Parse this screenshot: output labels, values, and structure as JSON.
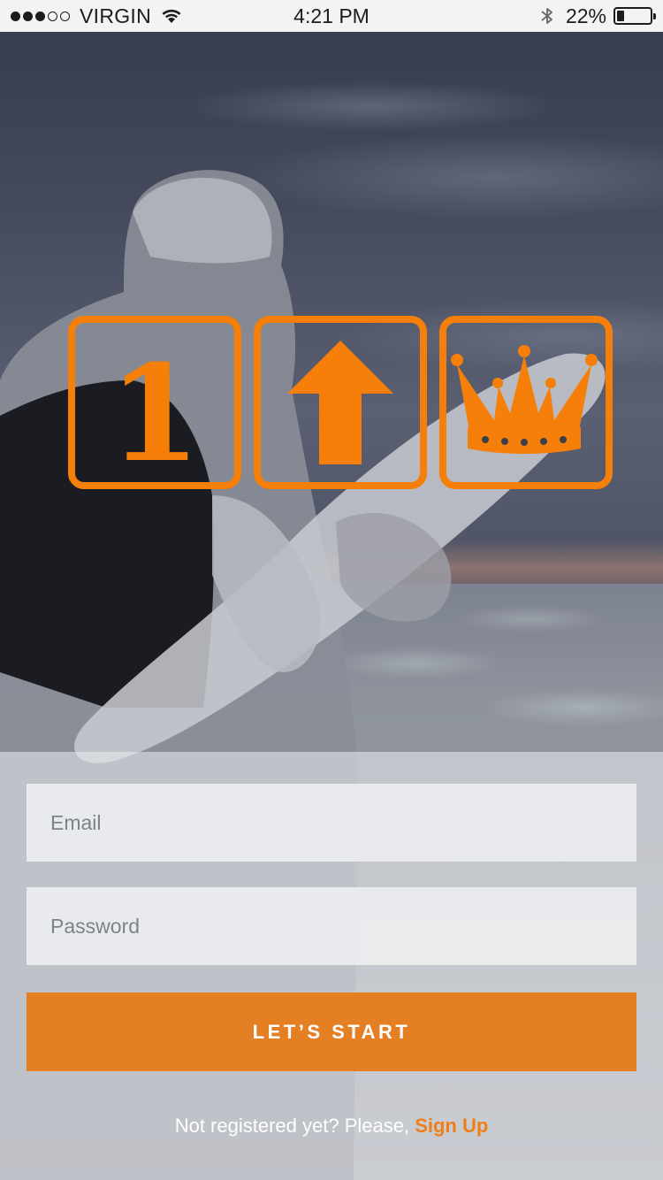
{
  "status_bar": {
    "carrier": "VIRGIN",
    "time": "4:21 PM",
    "battery_percent": "22%",
    "battery_level": 0.22,
    "signal_strength": 3,
    "signal_max": 5,
    "icons": [
      "wifi-icon",
      "bluetooth-icon",
      "battery-icon"
    ]
  },
  "logo": {
    "tile_1_text": "1",
    "tile_2_icon": "arrow-up-icon",
    "tile_3_icon": "crown-icon",
    "color": "#f57f08"
  },
  "form": {
    "email_placeholder": "Email",
    "password_placeholder": "Password",
    "start_button_label": "LET’S START",
    "signup_prompt": "Not registered yet? Please, ",
    "signup_link": "Sign Up"
  },
  "colors": {
    "accent": "#e47f23",
    "signup_link": "#ef7f1a"
  }
}
